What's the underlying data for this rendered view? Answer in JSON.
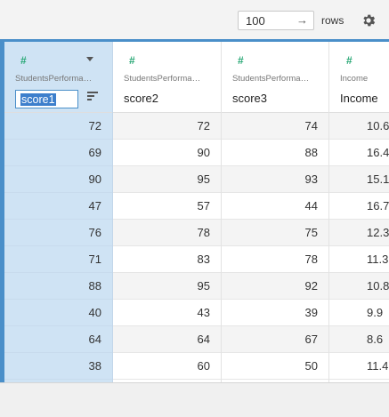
{
  "toolbar": {
    "rows_value": "100",
    "rows_label": "rows",
    "go_icon": "arrow-right-icon",
    "settings_icon": "gear-icon"
  },
  "columns": [
    {
      "type_icon": "#",
      "source": "StudentsPerforma…",
      "name": "score1"
    },
    {
      "type_icon": "#",
      "source": "StudentsPerforma…",
      "name": "score2"
    },
    {
      "type_icon": "#",
      "source": "StudentsPerforma…",
      "name": "score3"
    },
    {
      "type_icon": "#",
      "source": "Income",
      "name": "Income"
    }
  ],
  "rows": [
    [
      "72",
      "72",
      "74",
      "10.6"
    ],
    [
      "69",
      "90",
      "88",
      "16.4"
    ],
    [
      "90",
      "95",
      "93",
      "15.1"
    ],
    [
      "47",
      "57",
      "44",
      "16.7"
    ],
    [
      "76",
      "78",
      "75",
      "12.3"
    ],
    [
      "71",
      "83",
      "78",
      "11.3"
    ],
    [
      "88",
      "95",
      "92",
      "10.8"
    ],
    [
      "40",
      "43",
      "39",
      "9.9"
    ],
    [
      "64",
      "64",
      "67",
      "8.6"
    ],
    [
      "38",
      "60",
      "50",
      "11.4"
    ]
  ],
  "colors": {
    "accent": "#4a8fc9",
    "selected_column": "#cfe3f4",
    "numeric_type": "#2aa876"
  }
}
